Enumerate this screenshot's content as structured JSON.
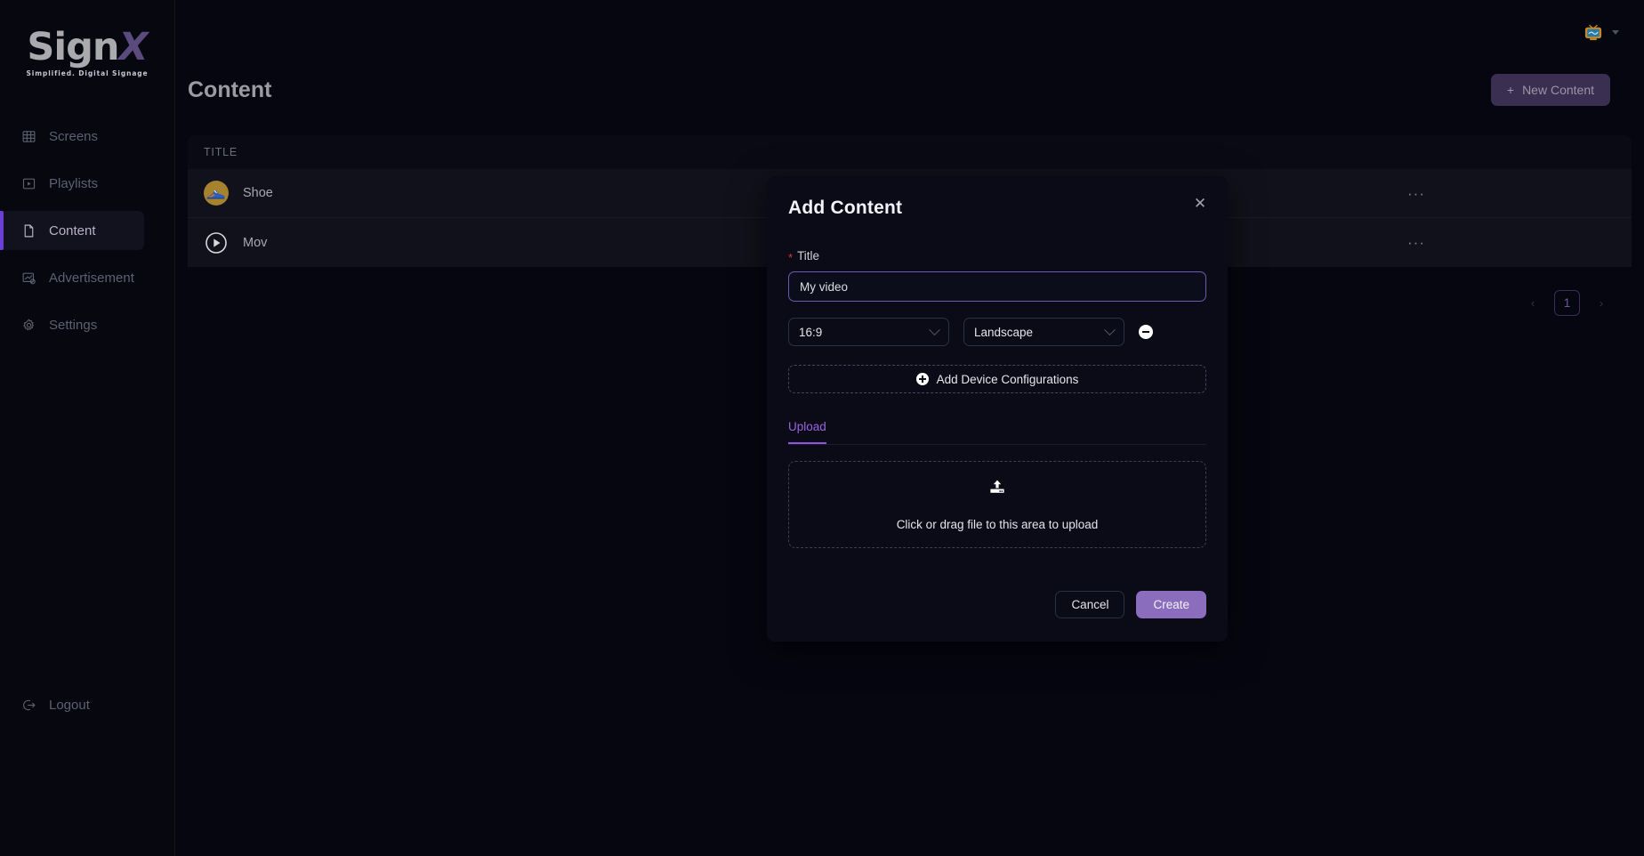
{
  "brand": {
    "name_part1": "Sign",
    "name_part2": "X",
    "tagline": "Simplified. Digital Signage",
    "logo_gray": "#a9a9ae",
    "logo_purple": "#5b4a7e"
  },
  "sidebar": {
    "items": [
      {
        "label": "Screens",
        "icon": "grid-icon",
        "active": false
      },
      {
        "label": "Playlists",
        "icon": "play-square-icon",
        "active": false
      },
      {
        "label": "Content",
        "icon": "file-icon",
        "active": true
      },
      {
        "label": "Advertisement",
        "icon": "chart-ad-icon",
        "active": false
      },
      {
        "label": "Settings",
        "icon": "gear-icon",
        "active": false
      }
    ],
    "logout": {
      "label": "Logout",
      "icon": "logout-icon"
    },
    "active_accent": "#6b3fd4"
  },
  "topbar": {
    "avatar_icon": "tv-avatar-icon",
    "caret_icon": "chevron-down-icon"
  },
  "page": {
    "title": "Content",
    "new_button": {
      "label": "New Content",
      "icon": "plus-icon",
      "color": "#3a2f50"
    }
  },
  "table": {
    "columns": [
      "TITLE"
    ],
    "rows": [
      {
        "title": "Shoe",
        "thumb": "sneaker-thumbnail",
        "actions": "···"
      },
      {
        "title": "Mov",
        "thumb": "play-circle-icon",
        "actions": "···"
      }
    ]
  },
  "pagination": {
    "prev": "‹",
    "next": "›",
    "current_page": "1"
  },
  "modal": {
    "title": "Add Content",
    "close_icon": "close-icon",
    "title_field": {
      "label": "Title",
      "required_mark": "*",
      "value": "My video",
      "placeholder": "",
      "focus_color": "#6d5ab0"
    },
    "device_config": {
      "ratio": {
        "value": "16:9",
        "chevron": "chevron-down-icon"
      },
      "orientation": {
        "value": "Landscape",
        "chevron": "chevron-down-icon"
      },
      "remove_icon": "minus-circle-icon"
    },
    "add_config_button": {
      "label": "Add Device Configurations",
      "icon": "plus-circle-icon"
    },
    "tabs": [
      {
        "label": "Upload",
        "active": true,
        "color": "#9254de"
      }
    ],
    "dropzone": {
      "icon": "upload-icon",
      "text": "Click or drag file to this area to upload"
    },
    "footer": {
      "cancel_label": "Cancel",
      "create_label": "Create",
      "create_color": "#8b6dbd"
    }
  }
}
